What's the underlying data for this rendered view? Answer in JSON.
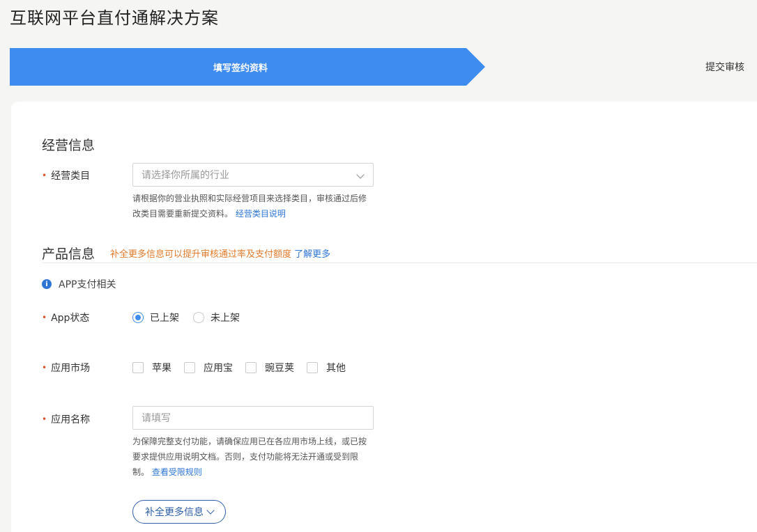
{
  "page": {
    "title": "互联网平台直付通解决方案"
  },
  "steps": {
    "active_label": "填写签约资料",
    "next_label": "提交审核"
  },
  "business": {
    "section_title": "经营信息",
    "category": {
      "label": "经营类目",
      "placeholder": "请选择你所属的行业",
      "help_text": "请根据你的营业执照和实际经营项目来选择类目，审核通过后修改类目需要重新提交资料。",
      "help_link": "经营类目说明"
    }
  },
  "product": {
    "section_title": "产品信息",
    "promo_text": "补全更多信息可以提升审核通过率及支付额度",
    "promo_link": "了解更多",
    "info_text": "APP支付相关",
    "app_status": {
      "label": "App状态",
      "options": [
        "已上架",
        "未上架"
      ],
      "selected": "已上架"
    },
    "app_market": {
      "label": "应用市场",
      "options": [
        "苹果",
        "应用宝",
        "豌豆荚",
        "其他"
      ]
    },
    "app_name": {
      "label": "应用名称",
      "placeholder": "请填写",
      "help_text": "为保障完整支付功能，请确保应用已在各应用市场上线，或已按要求提供应用说明文档。否则，支付功能将无法开通或受到限制。",
      "help_link": "查看受限规则"
    },
    "more_button": "补全更多信息"
  },
  "colors": {
    "primary": "#3f8cf0",
    "link": "#2e75d6",
    "promo": "#e27a2b",
    "required": "#e0502b"
  }
}
